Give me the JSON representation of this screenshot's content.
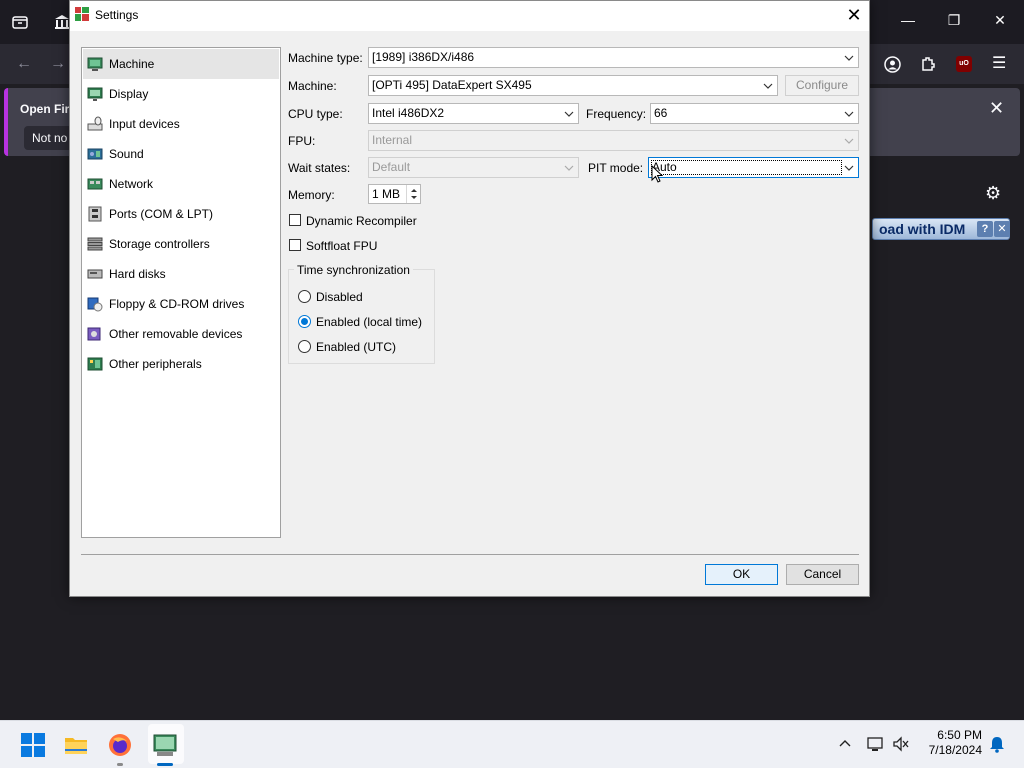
{
  "dialog": {
    "title": "Settings",
    "ok_label": "OK",
    "cancel_label": "Cancel"
  },
  "categories": [
    {
      "label": "Machine",
      "icon": "machine-icon",
      "selected": true
    },
    {
      "label": "Display",
      "icon": "display-icon"
    },
    {
      "label": "Input devices",
      "icon": "input-devices-icon"
    },
    {
      "label": "Sound",
      "icon": "sound-icon"
    },
    {
      "label": "Network",
      "icon": "network-icon"
    },
    {
      "label": "Ports (COM & LPT)",
      "icon": "ports-icon"
    },
    {
      "label": "Storage controllers",
      "icon": "storage-controllers-icon"
    },
    {
      "label": "Hard disks",
      "icon": "hard-disk-icon"
    },
    {
      "label": "Floppy & CD-ROM drives",
      "icon": "floppy-cdrom-icon"
    },
    {
      "label": "Other removable devices",
      "icon": "removable-devices-icon"
    },
    {
      "label": "Other peripherals",
      "icon": "peripherals-icon"
    }
  ],
  "machine": {
    "machine_type_label": "Machine type:",
    "machine_type_value": "[1989] i386DX/i486",
    "machine_label": "Machine:",
    "machine_value": "[OPTi 495] DataExpert SX495",
    "configure_label": "Configure",
    "cpu_type_label": "CPU type:",
    "cpu_type_value": "Intel i486DX2",
    "frequency_label": "Frequency:",
    "frequency_value": "66",
    "fpu_label": "FPU:",
    "fpu_value": "Internal",
    "wait_states_label": "Wait states:",
    "wait_states_value": "Default",
    "pit_mode_label": "PIT mode:",
    "pit_mode_value": "Auto",
    "memory_label": "Memory:",
    "memory_value": "1 MB",
    "dynamic_recompiler_label": "Dynamic Recompiler",
    "dynamic_recompiler_checked": false,
    "softfloat_fpu_label": "Softfloat FPU",
    "softfloat_fpu_checked": false,
    "time_sync": {
      "title": "Time synchronization",
      "options": [
        {
          "label": "Disabled",
          "checked": false
        },
        {
          "label": "Enabled (local time)",
          "checked": true
        },
        {
          "label": "Enabled (UTC)",
          "checked": false
        }
      ]
    }
  },
  "background": {
    "notification_title": "Open Fir",
    "notification_button": "Not no",
    "idm_label": "oad with IDM"
  },
  "taskbar": {
    "time": "6:50 PM",
    "date": "7/18/2024"
  },
  "colors": {
    "accent": "#0078d7",
    "dialog_bg": "#f0f0f0",
    "browser_bg": "#1f1e23"
  }
}
